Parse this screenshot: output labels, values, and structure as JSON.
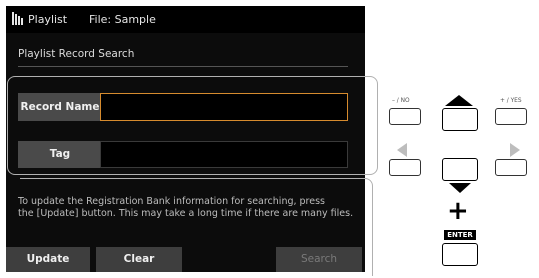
{
  "titlebar": {
    "app": "Playlist",
    "file": "File: Sample"
  },
  "panel": {
    "title": "Playlist Record Search"
  },
  "fields": {
    "record_name_label": "Record Name",
    "record_name_value": "",
    "tag_label": "Tag",
    "tag_value": ""
  },
  "info": {
    "line1": "To update the Registration Bank information for searching, press",
    "line2": "the [Update] button. This may take a long time if there are many files."
  },
  "buttons": {
    "update": "Update",
    "clear": "Clear",
    "search": "Search"
  },
  "panel_controls": {
    "no_label": "– / NO",
    "yes_label": "+ / YES",
    "plus_sign": "+",
    "enter_label": "ENTER"
  },
  "colors": {
    "focus_border": "#d68b2e",
    "screen_bg": "#0c0c0c"
  }
}
